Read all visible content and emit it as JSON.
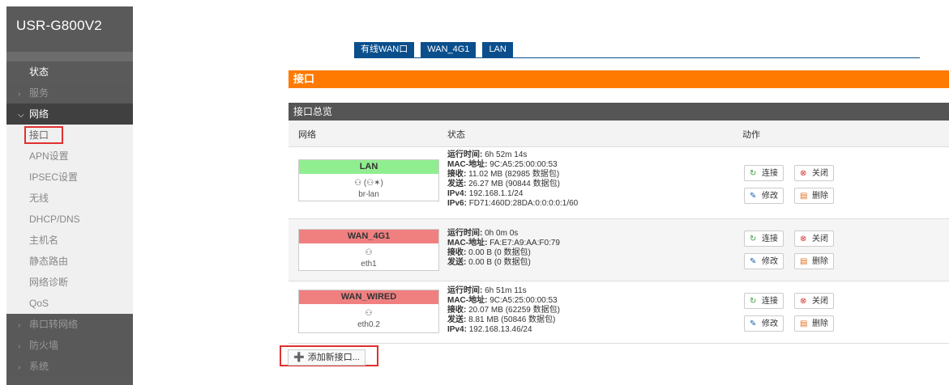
{
  "sidebar": {
    "brand": "USR-G800V2",
    "items": [
      {
        "label": "状态",
        "type": "top"
      },
      {
        "label": "服务",
        "type": "collapsed"
      },
      {
        "label": "网络",
        "type": "expanded"
      }
    ],
    "network_sub": [
      "接口",
      "APN设置",
      "IPSEC设置",
      "无线",
      "DHCP/DNS",
      "主机名",
      "静态路由",
      "网络诊断",
      "QoS"
    ],
    "bottom_items": [
      "串口转网络",
      "防火墙",
      "系统"
    ]
  },
  "tabs": [
    "有线WAN口",
    "WAN_4G1",
    "LAN"
  ],
  "page_title": "接口",
  "section_title": "接口总览",
  "table": {
    "headers": {
      "network": "网络",
      "status": "状态",
      "action": "动作"
    },
    "rows": [
      {
        "name": "LAN",
        "icon_text": "(  )",
        "device": "br-lan",
        "uptime_label": "运行时间:",
        "uptime": "6h 52m 14s",
        "mac_label": "MAC-地址:",
        "mac": "9C:A5:25:00:00:53",
        "rx_label": "接收:",
        "rx": "11.02 MB (82985 数据包)",
        "tx_label": "发送:",
        "tx": "26.27 MB (90844 数据包)",
        "ipv4_label": "IPv4:",
        "ipv4": "192.168.1.1/24",
        "ipv6_label": "IPv6:",
        "ipv6": "FD71:460D:28DA:0:0:0:0:1/60"
      },
      {
        "name": "WAN_4G1",
        "icon_text": "",
        "device": "eth1",
        "uptime_label": "运行时间:",
        "uptime": "0h 0m 0s",
        "mac_label": "MAC-地址:",
        "mac": "FA:E7:A9:AA:F0:79",
        "rx_label": "接收:",
        "rx": "0.00 B (0 数据包)",
        "tx_label": "发送:",
        "tx": "0.00 B (0 数据包)"
      },
      {
        "name": "WAN_WIRED",
        "icon_text": "",
        "device": "eth0.2",
        "uptime_label": "运行时间:",
        "uptime": "6h 51m 11s",
        "mac_label": "MAC-地址:",
        "mac": "9C:A5:25:00:00:53",
        "rx_label": "接收:",
        "rx": "20.07 MB (62259 数据包)",
        "tx_label": "发送:",
        "tx": "8.81 MB (50846 数据包)",
        "ipv4_label": "IPv4:",
        "ipv4": "192.168.13.46/24"
      }
    ],
    "buttons": {
      "connect": "连接",
      "close": "关闭",
      "edit": "修改",
      "delete": "删除"
    }
  },
  "add_button": "添加新接口..."
}
